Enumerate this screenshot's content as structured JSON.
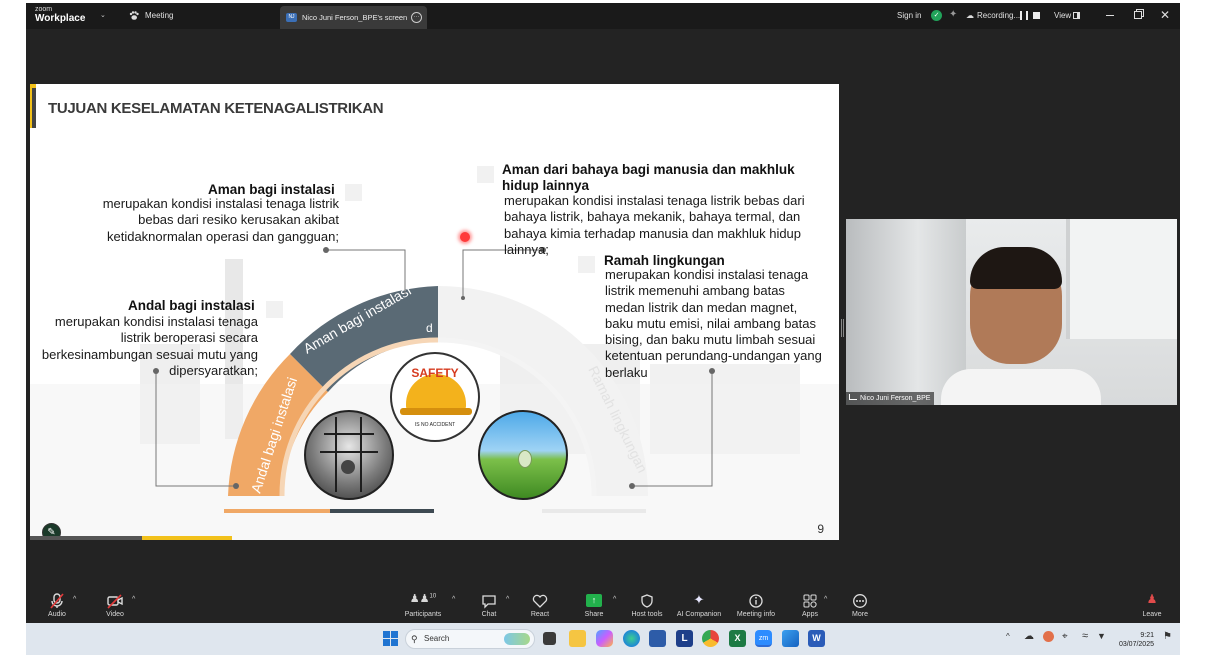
{
  "zoom": {
    "logo_top": "zoom",
    "logo_bottom": "Workplace",
    "meeting_tab": "Meeting",
    "share_badge": "NJ",
    "share_tab": "Nico Juni Ferson_BPE's screen",
    "sign_in": "Sign in",
    "recording": "Recording...",
    "view": "View"
  },
  "slide": {
    "title": "TUJUAN KESELAMATAN KETENAGALISTRIKAN",
    "page_number": "9",
    "aman_instalasi_head": "Aman bagi instalasi",
    "aman_instalasi_body": [
      "merupakan kondisi instalasi tenaga listrik",
      "bebas dari resiko kerusakan akibat",
      "ketidaknormalan operasi dan gangguan;"
    ],
    "andal_head": "Andal bagi instalasi",
    "andal_body": [
      "merupakan kondisi instalasi tenaga",
      "listrik beroperasi secara",
      "berkesinambungan sesuai mutu yang",
      "dipersyaratkan;"
    ],
    "aman_manusia_head": [
      "Aman dari bahaya bagi manusia dan makhluk",
      "hidup lainnya"
    ],
    "aman_manusia_body": [
      "merupakan kondisi instalasi tenaga listrik bebas dari",
      "bahaya listrik, bahaya mekanik, bahaya termal, dan",
      "bahaya kimia terhadap manusia dan makhluk hidup",
      "lainnya;"
    ],
    "ramah_head": "Ramah lingkungan",
    "ramah_body": [
      "merupakan kondisi instalasi tenaga",
      "listrik memenuhi ambang batas",
      "medan listrik dan medan magnet,",
      "baku mutu emisi, nilai ambang batas",
      "bising, dan baku mutu limbah sesuai",
      "ketentuan perundang-undangan yang",
      "berlaku"
    ],
    "arc_andal": "Andal bagi instalasi",
    "arc_aman": "Aman bagi instalasi",
    "arc_ramah": "Ramah lingkungan",
    "arc_cut": "d",
    "safety_top": "SAFETY",
    "safety_bottom": "IS NO ACCIDENT",
    "colors": {
      "orange": "#f0a866",
      "slate": "#5a6a75",
      "yellow": "#f2c11b"
    }
  },
  "video": {
    "name": "Nico Juni Ferson_BPE"
  },
  "toolbar": {
    "audio": "Audio",
    "video": "Video",
    "participants": "Participants",
    "participants_count": "10",
    "chat": "Chat",
    "react": "React",
    "share": "Share",
    "host_tools": "Host tools",
    "ai_companion": "AI Companion",
    "meeting_info": "Meeting info",
    "apps": "Apps",
    "more": "More",
    "leave": "Leave"
  },
  "taskbar": {
    "search_placeholder": "Search",
    "time": "9:21",
    "date": "03/07/2025"
  }
}
